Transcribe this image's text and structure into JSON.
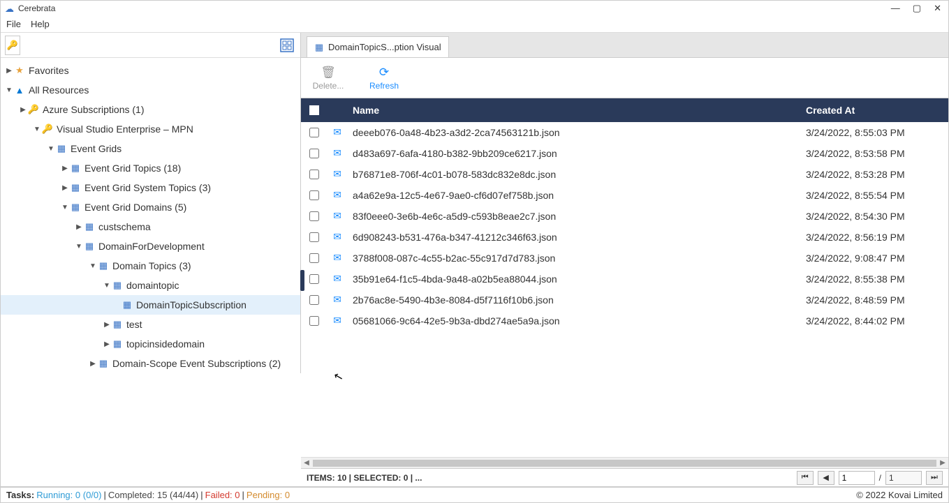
{
  "window": {
    "title": "Cerebrata"
  },
  "menu": {
    "file": "File",
    "help": "Help"
  },
  "tree": {
    "favorites": "Favorites",
    "all_resources": "All Resources",
    "azure_subs": "Azure Subscriptions (1)",
    "vs_enterprise": "Visual Studio Enterprise – MPN",
    "event_grids": "Event Grids",
    "eg_topics": "Event Grid Topics (18)",
    "eg_system_topics": "Event Grid System Topics (3)",
    "eg_domains": "Event Grid Domains (5)",
    "custschema": "custschema",
    "domain_dev": "DomainForDevelopment",
    "domain_topics": "Domain Topics (3)",
    "domaintopic": "domaintopic",
    "domain_topic_sub": "DomainTopicSubscription",
    "test": "test",
    "topicinside": "topicinsidedomain",
    "domain_scope_subs": "Domain-Scope Event Subscriptions (2)"
  },
  "tab": {
    "label": "DomainTopicS...ption Visual"
  },
  "actions": {
    "delete": "Delete...",
    "refresh": "Refresh"
  },
  "table": {
    "headers": {
      "name": "Name",
      "created": "Created At"
    },
    "rows": [
      {
        "name": "deeeb076-0a48-4b23-a3d2-2ca74563121b.json",
        "created": "3/24/2022, 8:55:03 PM"
      },
      {
        "name": "d483a697-6afa-4180-b382-9bb209ce6217.json",
        "created": "3/24/2022, 8:53:58 PM"
      },
      {
        "name": "b76871e8-706f-4c01-b078-583dc832e8dc.json",
        "created": "3/24/2022, 8:53:28 PM"
      },
      {
        "name": "a4a62e9a-12c5-4e67-9ae0-cf6d07ef758b.json",
        "created": "3/24/2022, 8:55:54 PM"
      },
      {
        "name": "83f0eee0-3e6b-4e6c-a5d9-c593b8eae2c7.json",
        "created": "3/24/2022, 8:54:30 PM"
      },
      {
        "name": "6d908243-b531-476a-b347-41212c346f63.json",
        "created": "3/24/2022, 8:56:19 PM"
      },
      {
        "name": "3788f008-087c-4c55-b2ac-55c917d7d783.json",
        "created": "3/24/2022, 9:08:47 PM"
      },
      {
        "name": "35b91e64-f1c5-4bda-9a48-a02b5ea88044.json",
        "created": "3/24/2022, 8:55:38 PM"
      },
      {
        "name": "2b76ac8e-5490-4b3e-8084-d5f7116f10b6.json",
        "created": "3/24/2022, 8:48:59 PM"
      },
      {
        "name": "05681066-9c64-42e5-9b3a-dbd274ae5a9a.json",
        "created": "3/24/2022, 8:44:02 PM"
      }
    ]
  },
  "footer": {
    "items_text": "ITEMS: 10 | SELECTED: 0 |  ...",
    "page_current": "1",
    "page_sep": "/",
    "page_total": "1"
  },
  "status": {
    "tasks_label": "Tasks:",
    "running_label": "Running:",
    "running_value": "0 (0/0)",
    "completed_label": "Completed:",
    "completed_value": "15 (44/44)",
    "failed_label": "Failed:",
    "failed_value": "0",
    "pending_label": "Pending:",
    "pending_value": "0",
    "copyright": "© 2022 Kovai Limited"
  }
}
